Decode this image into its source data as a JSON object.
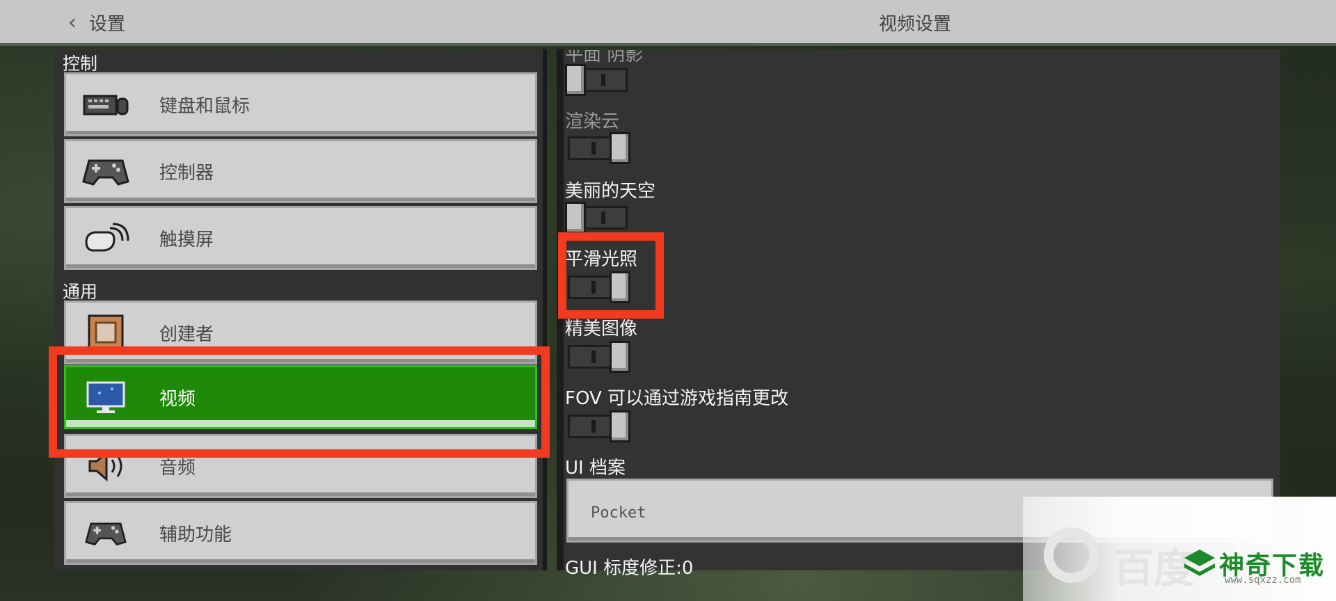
{
  "header": {
    "back_label": "设置",
    "title": "视频设置"
  },
  "left": {
    "sections": [
      {
        "label": "控制"
      },
      {
        "label": "通用"
      }
    ],
    "items": [
      {
        "label": "键盘和鼠标",
        "icon": "keyboard-mouse-icon"
      },
      {
        "label": "控制器",
        "icon": "gamepad-icon"
      },
      {
        "label": "触摸屏",
        "icon": "touch-icon"
      },
      {
        "label": "创建者",
        "icon": "command-block-icon"
      },
      {
        "label": "视频",
        "icon": "monitor-icon",
        "active": true
      },
      {
        "label": "音频",
        "icon": "speaker-icon"
      },
      {
        "label": "辅助功能",
        "icon": "gamepad-icon"
      }
    ]
  },
  "right": {
    "options": [
      {
        "label": "平面 阴影",
        "state": "off",
        "faded": true
      },
      {
        "label": "渲染云",
        "state": "on",
        "faded": true
      },
      {
        "label": "美丽的天空",
        "state": "off"
      },
      {
        "label": "平滑光照",
        "state": "on"
      },
      {
        "label": "精美图像",
        "state": "on"
      },
      {
        "label": "FOV 可以通过游戏指南更改",
        "state": "on"
      }
    ],
    "ui_profile_label": "UI 档案",
    "ui_profile_value": "Pocket",
    "gui_scale_label": "GUI 标度修正:0"
  },
  "watermark": {
    "faded_text": "百度",
    "brand": "神奇下载",
    "url": "www.sqxzz.com"
  },
  "colors": {
    "active_green": "#1f8a0a",
    "highlight_red": "#f23b1e",
    "titlebar": "#c7c7c7"
  }
}
